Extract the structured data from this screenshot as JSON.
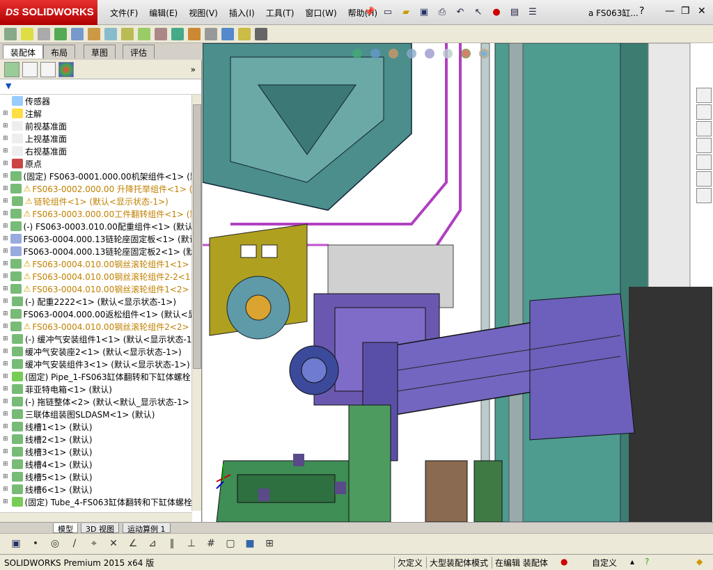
{
  "app": {
    "logo_text": "SOLIDWORKS",
    "doc_title": "a  FS063缸...",
    "help": "?"
  },
  "menu": [
    "文件(F)",
    "编辑(E)",
    "视图(V)",
    "插入(I)",
    "工具(T)",
    "窗口(W)",
    "帮助(H)"
  ],
  "tabs": [
    "装配体",
    "布局",
    "草图",
    "评估"
  ],
  "tree": [
    {
      "label": "传感器",
      "icon": "sensor-icon",
      "warn": false
    },
    {
      "label": "注解",
      "icon": "annotation-icon",
      "warn": false
    },
    {
      "label": "前视基准面",
      "icon": "plane-icon",
      "warn": false
    },
    {
      "label": "上视基准面",
      "icon": "plane-icon",
      "warn": false
    },
    {
      "label": "右视基准面",
      "icon": "plane-icon",
      "warn": false
    },
    {
      "label": "原点",
      "icon": "origin-icon",
      "warn": false
    },
    {
      "label": "(固定) FS063-0001.000.00机架组件<1> (默",
      "icon": "assembly-icon",
      "warn": false
    },
    {
      "label": "FS063-0002.000.00 升降托举组件<1> (默",
      "icon": "assembly-icon",
      "warn": true
    },
    {
      "label": "链轮组件<1> (默认<显示状态-1>)",
      "icon": "assembly-icon",
      "warn": true
    },
    {
      "label": "FS063-0003.000.00工件翻转组件<1> (默",
      "icon": "assembly-icon",
      "warn": true
    },
    {
      "label": "(-) FS063-0003.010.00配重组件<1> (默认",
      "icon": "assembly-icon",
      "warn": false
    },
    {
      "label": "FS063-0004.000.13链轮座固定板<1> (默认",
      "icon": "part-icon",
      "warn": false
    },
    {
      "label": "FS063-0004.000.13链轮座固定板2<1> (默认",
      "icon": "part-icon",
      "warn": false
    },
    {
      "label": "FS063-0004.010.00钢丝滚轮组件1<1> (默",
      "icon": "assembly-icon",
      "warn": true
    },
    {
      "label": "FS063-0004.010.00钢丝滚轮组件2-2<1> (默",
      "icon": "assembly-icon",
      "warn": true
    },
    {
      "label": "FS063-0004.010.00钢丝滚轮组件1<2> (默",
      "icon": "assembly-icon",
      "warn": true
    },
    {
      "label": "(-) 配重2222<1> (默认<显示状态-1>)",
      "icon": "assembly-icon",
      "warn": false
    },
    {
      "label": "FS063-0004.000.00返松组件<1> (默认<显示",
      "icon": "assembly-icon",
      "warn": false
    },
    {
      "label": "FS063-0004.010.00钢丝滚轮组件2<2> (默",
      "icon": "assembly-icon",
      "warn": true
    },
    {
      "label": "(-) 缓冲气安装组件1<1> (默认<显示状态-1",
      "icon": "assembly-icon",
      "warn": false
    },
    {
      "label": "缓冲气安装座2<1> (默认<显示状态-1>)",
      "icon": "assembly-icon",
      "warn": false
    },
    {
      "label": "缓冲气安装组件3<1> (默认<显示状态-1>)",
      "icon": "assembly-icon",
      "warn": false
    },
    {
      "label": "(固定) Pipe_1-FS063缸体翻转和下缸体螺栓",
      "icon": "pipe-icon",
      "warn": false
    },
    {
      "label": "菲亚特电箱<1> (默认)",
      "icon": "assembly-icon",
      "warn": false
    },
    {
      "label": "(-) 拖链整体<2> (默认<默认_显示状态-1>",
      "icon": "assembly-icon",
      "warn": false
    },
    {
      "label": "三联体组装图SLDASM<1> (默认)",
      "icon": "assembly-icon",
      "warn": false
    },
    {
      "label": "线槽1<1> (默认)",
      "icon": "assembly-icon",
      "warn": false
    },
    {
      "label": "线槽2<1> (默认)",
      "icon": "assembly-icon",
      "warn": false
    },
    {
      "label": "线槽3<1> (默认)",
      "icon": "assembly-icon",
      "warn": false
    },
    {
      "label": "线槽4<1> (默认)",
      "icon": "assembly-icon",
      "warn": false
    },
    {
      "label": "线槽5<1> (默认)",
      "icon": "assembly-icon",
      "warn": false
    },
    {
      "label": "线槽6<1> (默认)",
      "icon": "assembly-icon",
      "warn": false
    },
    {
      "label": "(固定) Tube_4-FS063缸体翻转和下缸体螺栓",
      "icon": "pipe-icon",
      "warn": false
    }
  ],
  "model_tabs": [
    "模型",
    "3D 视图",
    "运动算例 1"
  ],
  "status": {
    "product": "SOLIDWORKS Premium 2015 x64 版",
    "underdefined": "欠定义",
    "large_mode": "大型装配体模式",
    "editing": "在编辑 装配体",
    "custom": "自定义"
  }
}
